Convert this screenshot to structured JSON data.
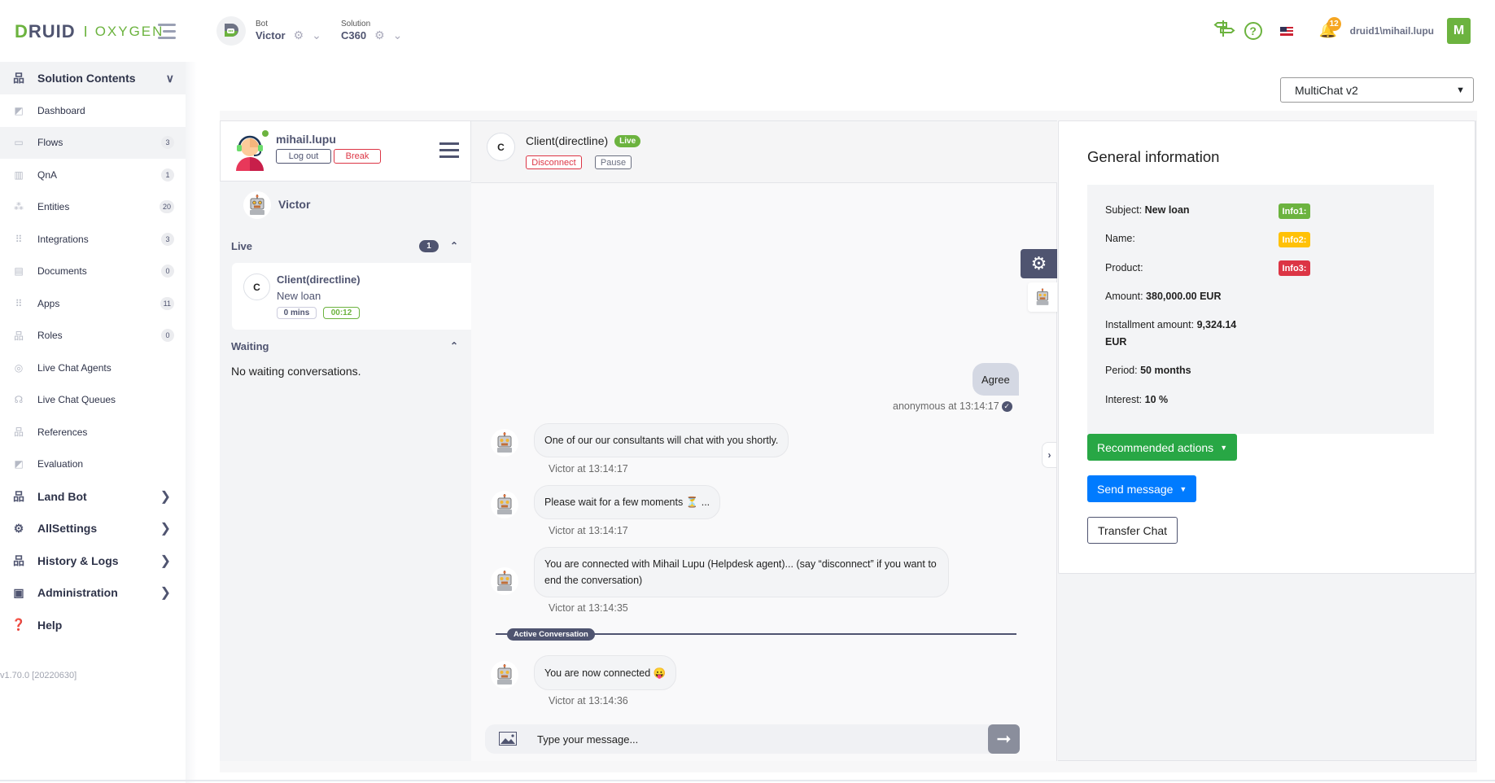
{
  "header": {
    "logo_main": "RUID",
    "logo_d": "D",
    "logo_sep": "I",
    "logo_sub": "OXYGEN",
    "bot_label": "Bot",
    "bot_value": "Victor",
    "solution_label": "Solution",
    "solution_value": "C360",
    "notifications_count": "12",
    "username": "druid1\\mihail.lupu",
    "user_initial": "M",
    "help_glyph": "?"
  },
  "sidebar": {
    "section_title": "Solution Contents",
    "items": [
      {
        "label": "Dashboard",
        "icon": "chart-icon",
        "count": null
      },
      {
        "label": "Flows",
        "icon": "flows-icon",
        "count": "3"
      },
      {
        "label": "QnA",
        "icon": "book-icon",
        "count": "1"
      },
      {
        "label": "Entities",
        "icon": "entities-icon",
        "count": "20"
      },
      {
        "label": "Integrations",
        "icon": "grid-icon",
        "count": "3"
      },
      {
        "label": "Documents",
        "icon": "document-icon",
        "count": "0"
      },
      {
        "label": "Apps",
        "icon": "grid-icon",
        "count": "11"
      },
      {
        "label": "Roles",
        "icon": "sitemap-icon",
        "count": "0"
      },
      {
        "label": "Live Chat Agents",
        "icon": "agent-icon",
        "count": null
      },
      {
        "label": "Live Chat Queues",
        "icon": "queue-icon",
        "count": null
      },
      {
        "label": "References",
        "icon": "sitemap-icon",
        "count": null
      },
      {
        "label": "Evaluation",
        "icon": "chart-icon",
        "count": null
      }
    ],
    "groups": [
      {
        "label": "Land Bot",
        "icon": "sitemap-icon"
      },
      {
        "label": "AllSettings",
        "icon": "gear-icon"
      },
      {
        "label": "History & Logs",
        "icon": "sitemap-icon"
      },
      {
        "label": "Administration",
        "icon": "admin-icon"
      },
      {
        "label": "Help",
        "icon": "help-icon"
      }
    ],
    "version": "v1.70.0 [20220630]"
  },
  "multichat_select": {
    "value": "MultiChat v2"
  },
  "agent_panel": {
    "agent_name": "mihail.lupu",
    "logout_label": "Log out",
    "break_label": "Break",
    "bot_name": "Victor",
    "live_label": "Live",
    "live_count": "1",
    "conversation": {
      "initial": "C",
      "name": "Client(directline)",
      "subject": "New loan",
      "wait_time": "0 mins",
      "duration": "00:12"
    },
    "waiting_label": "Waiting",
    "waiting_empty": "No waiting conversations."
  },
  "chat": {
    "client_initial": "C",
    "client_name": "Client(directline)",
    "status_badge": "Live",
    "disconnect_label": "Disconnect",
    "pause_label": "Pause",
    "messages": [
      {
        "from": "user",
        "text": "Agree",
        "meta": "anonymous at 13:14:17"
      },
      {
        "from": "bot",
        "text": "One of our our consultants will chat with you shortly.",
        "meta": "Victor at 13:14:17"
      },
      {
        "from": "bot",
        "text": "Please wait for a few moments ⏳ ...",
        "meta": "Victor at 13:14:17"
      },
      {
        "from": "bot",
        "text": "You are connected with Mihail Lupu (Helpdesk agent)... (say “disconnect” if you want to end the conversation)",
        "meta": "Victor at 13:14:35"
      },
      {
        "from": "bot",
        "text": "You are now connected 😛",
        "meta": "Victor at 13:14:36"
      }
    ],
    "divider_label": "Active Conversation",
    "input_placeholder": "Type your message...",
    "input_value": ""
  },
  "info": {
    "title": "General information",
    "rows": [
      {
        "label": "Subject:",
        "value": "New loan"
      },
      {
        "label": "Name:",
        "value": ""
      },
      {
        "label": "Product:",
        "value": ""
      },
      {
        "label": "Amount:",
        "value": "380,000.00 EUR"
      },
      {
        "label": "Installment amount:",
        "value": "9,324.14 EUR"
      },
      {
        "label": "Period:",
        "value": "50 months"
      },
      {
        "label": "Interest:",
        "value": "10 %"
      }
    ],
    "badges": [
      {
        "label": "Info1:",
        "color": "#6cb33f"
      },
      {
        "label": "Info2:",
        "color": "#ffc107"
      },
      {
        "label": "Info3:",
        "color": "#dc3545"
      }
    ],
    "recommended_actions_label": "Recommended actions",
    "send_message_label": "Send message",
    "transfer_chat_label": "Transfer Chat"
  },
  "colors": {
    "brand_green": "#6cb33f",
    "primary_dark": "#4f5470",
    "danger": "#dc3545",
    "success": "#28a745",
    "primary_blue": "#007bff",
    "warning": "#ffc107"
  }
}
